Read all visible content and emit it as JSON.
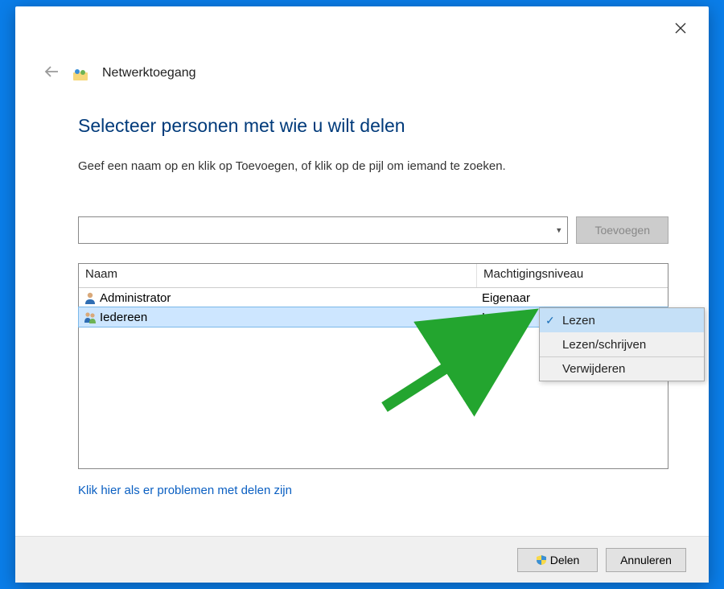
{
  "dialog": {
    "title": "Netwerktoegang"
  },
  "heading": "Selecteer personen met wie u wilt delen",
  "subheading": "Geef een naam op en klik op Toevoegen, of klik op de pijl om iemand te zoeken.",
  "input": {
    "value": "",
    "placeholder": ""
  },
  "buttons": {
    "add": "Toevoegen",
    "share": "Delen",
    "cancel": "Annuleren"
  },
  "table": {
    "columns": {
      "name": "Naam",
      "permission": "Machtigingsniveau"
    },
    "rows": [
      {
        "name": "Administrator",
        "permission": "Eigenaar",
        "icon": "user",
        "selected": false,
        "editable": false
      },
      {
        "name": "Iedereen",
        "permission": "Lezen",
        "icon": "group",
        "selected": true,
        "editable": true
      }
    ]
  },
  "menu": {
    "items": [
      {
        "label": "Lezen",
        "checked": true,
        "selected": true
      },
      {
        "label": "Lezen/schrijven",
        "checked": false,
        "selected": false
      },
      {
        "label": "Verwijderen",
        "checked": false,
        "selected": false,
        "separator": true
      }
    ]
  },
  "help_link": "Klik hier als er problemen met delen zijn",
  "colors": {
    "accent": "#0a7de8",
    "heading": "#003a7a",
    "selection": "#cde6ff",
    "link": "#0a5fc2",
    "arrow": "#23a52f"
  }
}
